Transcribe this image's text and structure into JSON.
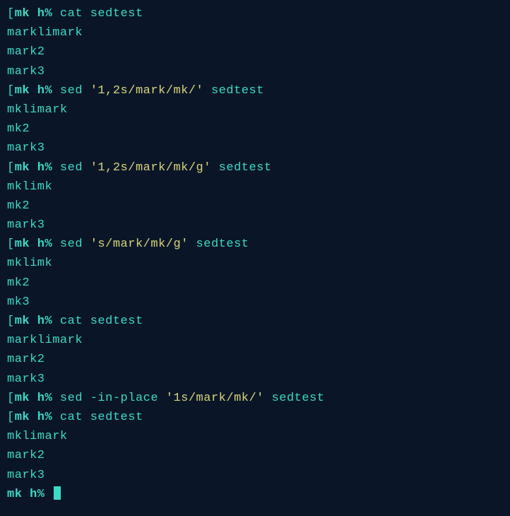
{
  "lines": [
    {
      "type": "cmd",
      "bracket": "[",
      "prompt": "mk h% ",
      "parts": [
        {
          "t": "command",
          "v": "cat sedtest"
        }
      ]
    },
    {
      "type": "out",
      "text": "marklimark"
    },
    {
      "type": "out",
      "text": "mark2"
    },
    {
      "type": "out",
      "text": "mark3"
    },
    {
      "type": "cmd",
      "bracket": "[",
      "prompt": "mk h% ",
      "parts": [
        {
          "t": "command",
          "v": "sed "
        },
        {
          "t": "string",
          "v": "'1,2s/mark/mk/'"
        },
        {
          "t": "command",
          "v": " sedtest"
        }
      ]
    },
    {
      "type": "out",
      "text": "mklimark"
    },
    {
      "type": "out",
      "text": "mk2"
    },
    {
      "type": "out",
      "text": "mark3"
    },
    {
      "type": "cmd",
      "bracket": "[",
      "prompt": "mk h% ",
      "parts": [
        {
          "t": "command",
          "v": "sed "
        },
        {
          "t": "string",
          "v": "'1,2s/mark/mk/g'"
        },
        {
          "t": "command",
          "v": " sedtest"
        }
      ]
    },
    {
      "type": "out",
      "text": "mklimk"
    },
    {
      "type": "out",
      "text": "mk2"
    },
    {
      "type": "out",
      "text": "mark3"
    },
    {
      "type": "cmd",
      "bracket": "[",
      "prompt": "mk h% ",
      "parts": [
        {
          "t": "command",
          "v": "sed "
        },
        {
          "t": "string",
          "v": "'s/mark/mk/g'"
        },
        {
          "t": "command",
          "v": " sedtest"
        }
      ]
    },
    {
      "type": "out",
      "text": "mklimk"
    },
    {
      "type": "out",
      "text": "mk2"
    },
    {
      "type": "out",
      "text": "mk3"
    },
    {
      "type": "cmd",
      "bracket": "[",
      "prompt": "mk h% ",
      "parts": [
        {
          "t": "command",
          "v": "cat sedtest"
        }
      ]
    },
    {
      "type": "out",
      "text": "marklimark"
    },
    {
      "type": "out",
      "text": "mark2"
    },
    {
      "type": "out",
      "text": "mark3"
    },
    {
      "type": "cmd",
      "bracket": "[",
      "prompt": "mk h% ",
      "parts": [
        {
          "t": "command",
          "v": "sed -in-place "
        },
        {
          "t": "string",
          "v": "'1s/mark/mk/'"
        },
        {
          "t": "command",
          "v": " sedtest"
        }
      ]
    },
    {
      "type": "cmd",
      "bracket": "[",
      "prompt": "mk h% ",
      "parts": [
        {
          "t": "command",
          "v": "cat sedtest"
        }
      ]
    },
    {
      "type": "out",
      "text": "mklimark"
    },
    {
      "type": "out",
      "text": "mark2"
    },
    {
      "type": "out",
      "text": "mark3"
    },
    {
      "type": "cursor",
      "prompt": "mk h% "
    }
  ]
}
